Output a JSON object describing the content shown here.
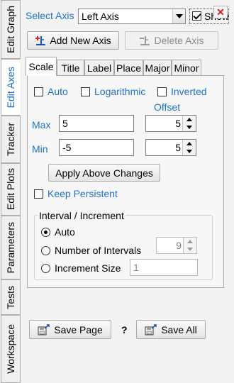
{
  "side_tabs": [
    "Edit Graph",
    "Edit Axes",
    "Tracker",
    "Edit Plots",
    "Parameters",
    "Tests",
    "Workspace"
  ],
  "header": {
    "select_axis_label": "Select Axis",
    "select_axis_value": "Left Axis",
    "show_label": "Show",
    "show_checked": true,
    "close_glyph": "✕"
  },
  "axis_buttons": {
    "add": "Add New Axis",
    "delete": "Delete Axis"
  },
  "tabs": [
    "Scale",
    "Title",
    "Label",
    "Place",
    "Major",
    "Minor"
  ],
  "active_tab": "Scale",
  "scale": {
    "auto_label": "Auto",
    "log_label": "Logarithmic",
    "inverted_label": "Inverted",
    "offset_label": "Offset",
    "max_label": "Max",
    "max_value": "5",
    "max_offset": "5",
    "min_label": "Min",
    "min_value": "-5",
    "min_offset": "5",
    "apply_button": "Apply Above Changes",
    "keep_persistent_label": "Keep Persistent"
  },
  "interval": {
    "title": "Interval / Increment",
    "auto_label": "Auto",
    "num_intervals_label": "Number of Intervals",
    "num_intervals_value": "9",
    "increment_label": "Increment Size",
    "increment_value": "1",
    "selected": "Auto"
  },
  "footer": {
    "save_page": "Save Page",
    "help": "?",
    "save_all": "Save All"
  },
  "colors": {
    "accent_text": "#1e73c8",
    "close_red": "#d02020"
  }
}
